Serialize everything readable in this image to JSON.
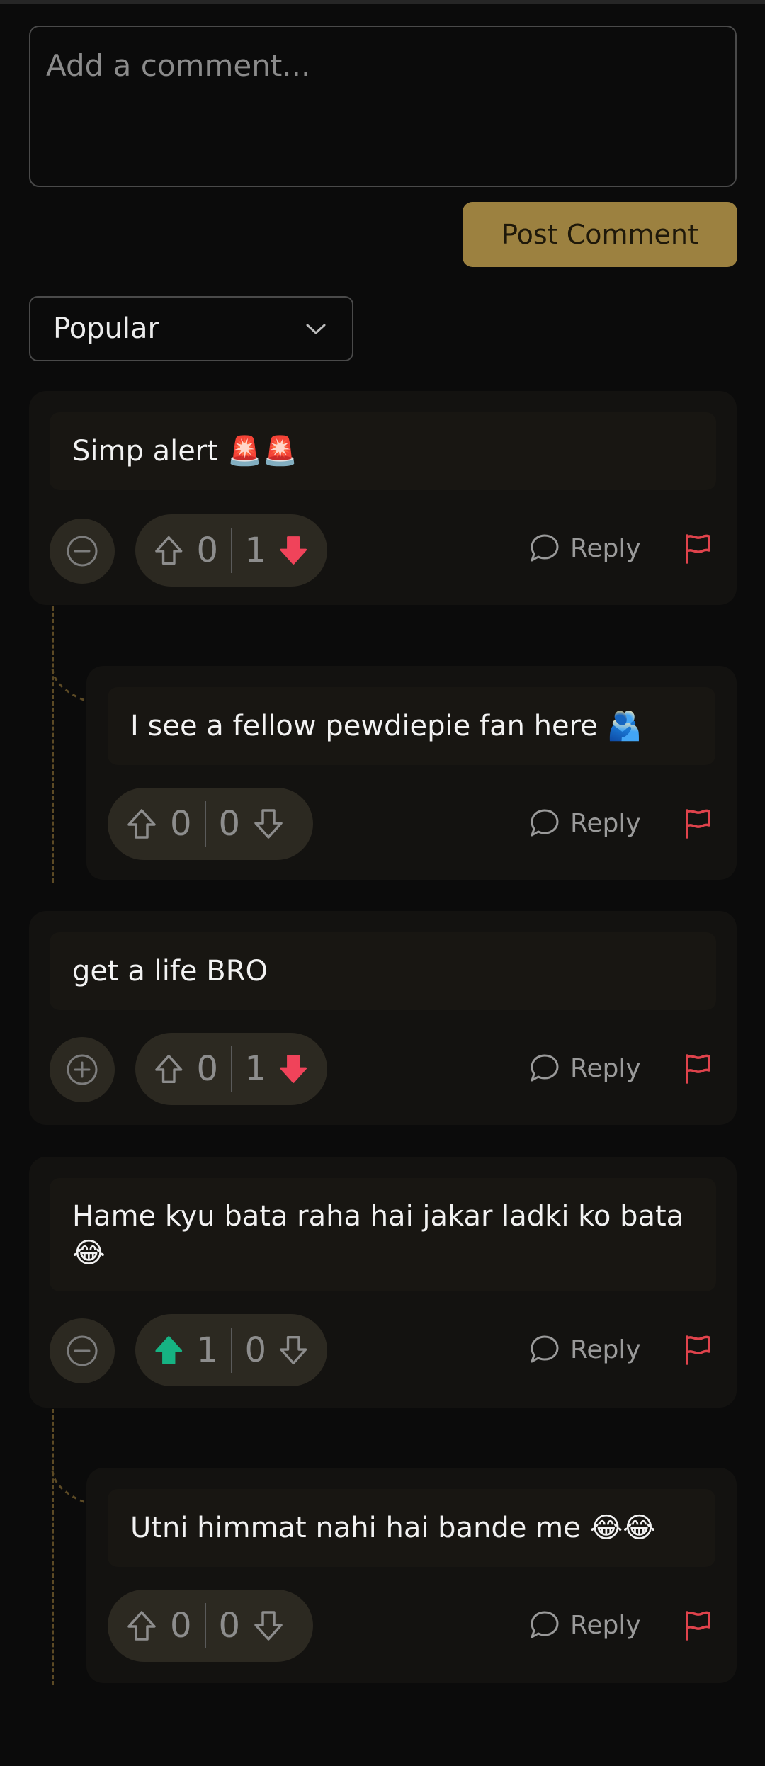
{
  "composer": {
    "placeholder": "Add a comment...",
    "post_label": "Post Comment"
  },
  "sort": {
    "selected": "Popular"
  },
  "comments": [
    {
      "text": "Simp alert 🚨🚨",
      "toggle": "collapse",
      "upvotes": "0",
      "downvotes": "1",
      "vote_state": "down",
      "reply_label": "Reply"
    },
    {
      "text": "I see a fellow pewdiepie fan here 🫂",
      "upvotes": "0",
      "downvotes": "0",
      "vote_state": "none",
      "reply_label": "Reply"
    },
    {
      "text": "get a life BRO",
      "toggle": "expand",
      "upvotes": "0",
      "downvotes": "1",
      "vote_state": "down",
      "reply_label": "Reply"
    },
    {
      "text": "Hame kyu bata raha hai jakar ladki ko bata 😂",
      "toggle": "collapse",
      "upvotes": "1",
      "downvotes": "0",
      "vote_state": "up",
      "reply_label": "Reply"
    },
    {
      "text": "Utni himmat nahi hai bande me 😂😂",
      "upvotes": "0",
      "downvotes": "0",
      "vote_state": "none",
      "reply_label": "Reply"
    }
  ],
  "colors": {
    "accent": "#9c8140",
    "upvote_active": "#16b383",
    "downvote_active": "#f0435a",
    "flag": "#e0434c"
  }
}
